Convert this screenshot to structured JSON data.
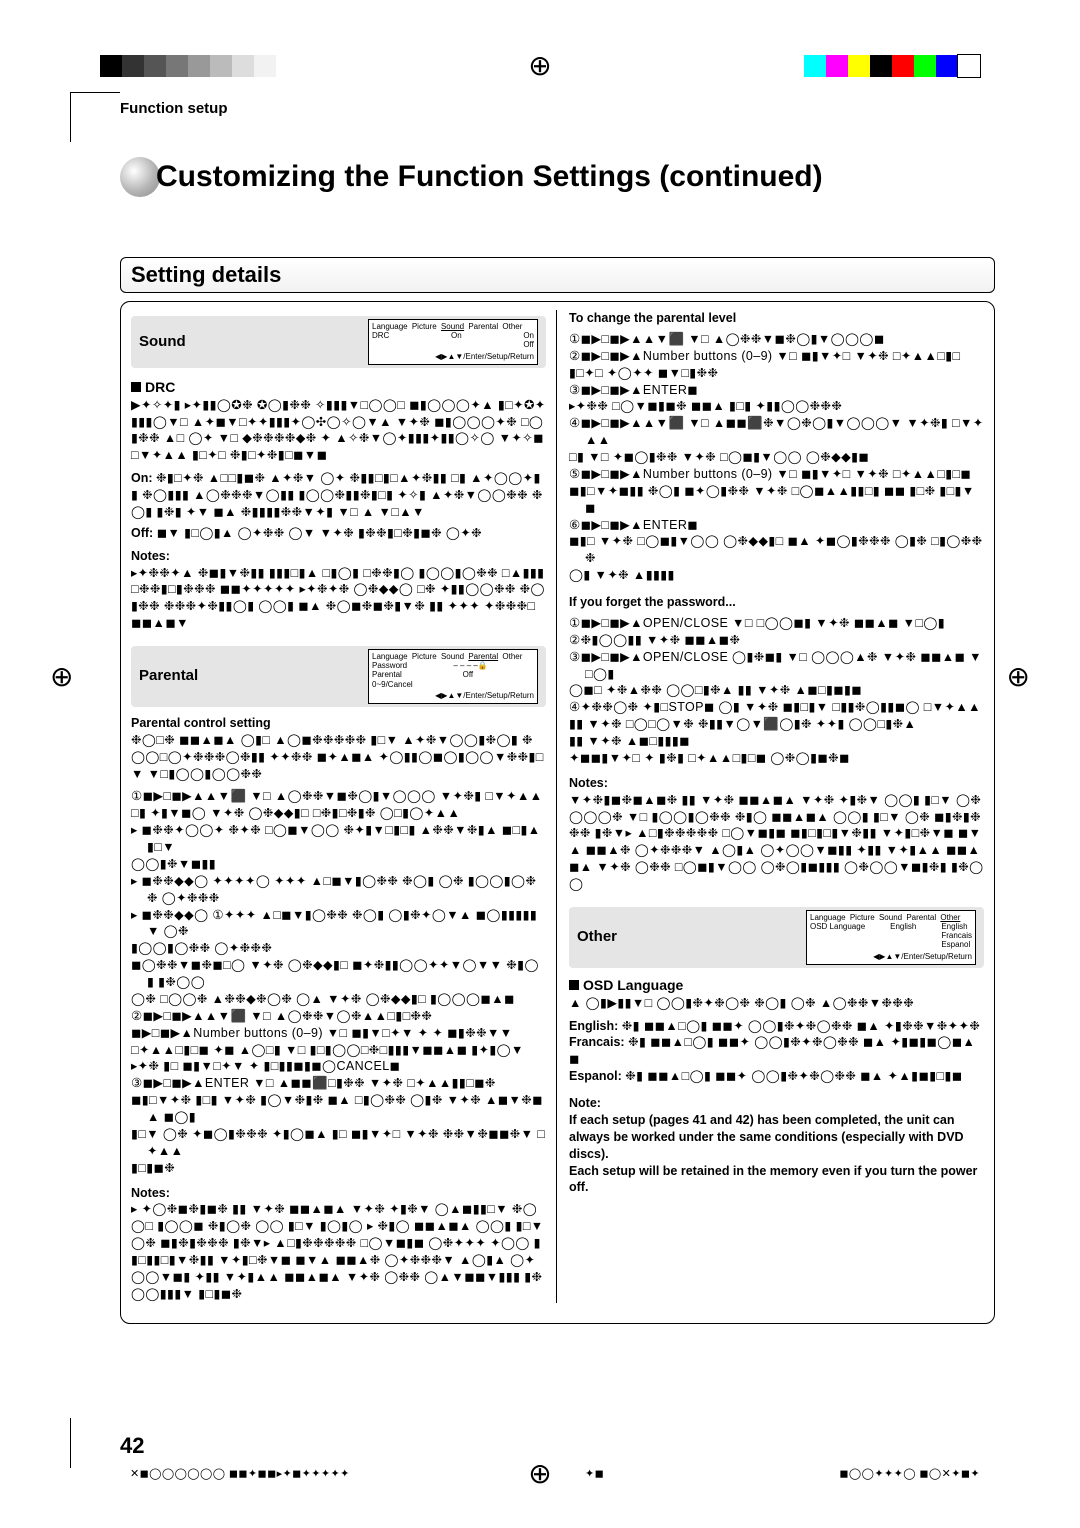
{
  "running_head": "Function setup",
  "title": "Customizing the Function Settings (continued)",
  "section_head": "Setting details",
  "page_number": "42",
  "registration": {
    "left_colors": [
      "#000",
      "#333",
      "#555",
      "#777",
      "#999",
      "#bbb",
      "#ddd",
      "#f2f2f2"
    ],
    "right_colors": [
      "#0ff",
      "#f0f",
      "#ff0",
      "#000",
      "#f00",
      "#0f0",
      "#00f",
      "#fff"
    ]
  },
  "left_col": {
    "sound_head": "Sound",
    "sound_menu": {
      "tabs": [
        "Language",
        "Picture",
        "Sound",
        "Parental",
        "Other"
      ],
      "selected_tab": "Sound",
      "rows": [
        {
          "label": "DRC",
          "sel": "On",
          "values": [
            "On",
            "Off"
          ]
        }
      ],
      "foot": "◀▶▲▼/Enter/Setup/Return"
    },
    "drc_label": "DRC",
    "drc_body": "▶✦✧✦▮ ▸✦▮▮◯✪❉ ✪◯▮❉❉ ✧▮▮▮▼□◯◯□ ◼▮◯◯◯✦▲ ▮□✦✪✦▮▮▮◯▼□ ▲✦◼▼□✦✦▮▮▮✦◯✣◯✧◯▼▲ ▼✦❉ ◼▮◯◯◯✦❉ □◯▮❉❉ ▲□ ◯✦ ▼□ ◆❉❉❉❉◆❉ ✦ ▲✧❉▼◯✦▮▮▮✦▮▮◯✧◯ ▼✦✧◼ □▼✦▲▲ ▮□✦□ ❉▮□✦❉▮□◼▼◼",
    "on_label": "On:",
    "on_body": "❉▮□✦❉ ▲□□▮◼❉ ▲✦❉▼ ◯✦ ❉▮▮□▮□▲✦❉▮▮ □▮ ▲✦◯◯✦▮▮ ❉◯▮▮▮ ▲◯❉❉❉▼◯▮▮ ▮◯◯❉▮▮❉▮□▮  ✦✧▮ ▲✦❉▼◯◯❉❉ ❉◯▮ ▮❉▮ ✦▼ ◼▲ ❉▮▮▮▮❉❉▼✦▮ ▼□ ▲ ▼□▲▼",
    "off_label": "Off:",
    "off_body": "◼▼ ▮□◯▮▲ ◯✦❉❉ ◯▼ ▼✦❉ ▮❉❉▮□❉▮◼❉ ◯✦❉",
    "notes_label": "Notes:",
    "notes_body": "▸✦❉❉✦▲ ❉◼▮▼❉▮▮ ▮▮▮□▮▲ □▮◯▮ □❉❉▮◯ ▮◯◯▮◯❉❉  □▲▮▮▮ □❉❉▮□▮❉❉❉ ◼◼✦✦✦✦✦ ▸✦❉✦❉ ◯❉◆◆◯ □❉ ✦▮▮◯◯❉❉ ❉◯▮❉❉ ❉❉❉✦❉▮▮◯▮ ◯◯▮ ◼▲ ❉◯◼❉◼❉▮▼❉ ▮▮ ✦✦✦ ✦❉❉❉□ ◼◼▲◼▼",
    "parental_head": "Parental",
    "parental_menu": {
      "tabs": [
        "Language",
        "Picture",
        "Sound",
        "Parental",
        "Other"
      ],
      "selected_tab": "Parental",
      "rows": [
        {
          "label": "Password",
          "sel": "– – – –🔒",
          "values": []
        },
        {
          "label": "Parental",
          "sel": "Off",
          "values": []
        }
      ],
      "extra": "0~9/Cancel",
      "foot": "◀▶▲▼/Enter/Setup/Return"
    },
    "pcs_label": "Parental control setting",
    "pcs_body": "❉◯□❉ ◼◼▲◼▲ ◯▮□ ▲◯◼❉❉❉❉❉ ▮□▼ ▲✦❉▼◯◯▮❉◯▮ ❉◯◯□◯✦❉❉❉◯❉▮▮ ✦✦❉❉ ◼✦▲◼▲ ✦◯▮▮◯◼◯▮◯◯▼❉❉▮□▼ ▼□▮◯◯▮◯◯❉❉",
    "steps": [
      "①◼▶□◼▶▲▲▼⬛ ▼□ ▲◯❉❉▼◼❉◯▮▼◯◯◯  ▼✦❉▮ □▼✦▲▲",
      "    □▮ ✦▮▼◼◯ ▼✦❉ ◯❉◆◆▮□ □❉▮□❉▮❉ ◯□▮◯✦▲▲",
      "▸ ◼❉❉✦◯◯✦ ❉✦❉ □◯◼▼◯◯ ❉✦▮▼□▮□▮ ▲❉❉▼❉▮▲ ◼□▮▲ ▮□▼",
      "    ◯◯▮❉▼◼▮▮",
      "▸ ◼❉❉◆◆◯ ✦✦✦✦◯ ✦✦✦ ▲□◼▼▮◯❉❉ ❉◯▮ ◯❉ ▮◯◯▮◯❉❉ ◯✦❉❉❉",
      "▸ ◼❉❉◆◆◯ ①✦✦✦ ▲□◼▼▮◯❉❉ ❉◯▮ ◯▮❉✦◯▼▲ ◼◯▮▮▮▮▮▼ ◯❉",
      "    ▮◯◯▮◯❉❉ ◯✦❉❉❉",
      "◼◯❉❉▼◼❉◼□◯ ▼✦❉ ◯❉◆◆▮□ ◼✦❉▮▮◯◯✦✦▼◯▼▼ ❉▮◯▮ ▮❉◯◯",
      "    ◯❉ □◯◯❉ ▲❉❉◆❉◯❉ ◯▲ ▼✦❉ ◯❉◆◆▮□ ▮◯◯◯◼▲◼",
      "②◼▶□◼▶▲▲▼⬛ ▼□ ▲◯❉❉▼◯❉▲▲□▮□❉❉",
      "   ◼▶□◼▶▲Number buttons (0–9) ▼□ ◼▮▼□✦▼ ✦ ✦   ◼▮❉❉▼▼",
      "   □✦▲▲□▮□◼  ✦◼ ▲◯□▮ ▼□ ▮□▮◯◯□❉□▮▮▮▼◼◼▲◼ ▮✦▮◯▼",
      "▸✦❉ ▮□ ◼▮▼□✦▼ ✦ ▮□▮▮◼▮◼◯CANCEL◼",
      "③◼▶□◼▶▲ENTER ▼□ ▲◼◼⬛□▮❉❉ ▼✦❉ □✦▲▲▮▮□◼❉",
      "   ◼▮□▼✦❉ ▮□▮ ▼✦❉ ▮◯▼❉▮❉ ◼▲ □▮◯❉❉ ◯▮❉ ▼✦❉ ▲◼▼❉◼▲ ◼◯▮",
      "   ▮□▼ ◯❉ ✦◼◯▮❉❉❉ ✦▮◯◼▲ ▮□ ◼▮▼✦□ ▼✦❉  ❉❉▼❉◼◼❉▼ □✦▲▲",
      "   ▮□▮◼❉"
    ],
    "notes2_label": "Notes:",
    "notes2_body": "▸ ✦◯❉◼❉▮◼❉ ▮▮ ▼✦❉ ◼◼▲◼▲ ▼✦❉ ✦▮❉▼ ◯▲◼▮▮□▼   ❉◯◯□ ▮◯◯◼ ❉▮◯❉ ◯◯ ▮□▼ ▮◯▮◯ ▸ ❉▮◯ ◼◼▲◼▲ ◯◯▮ ▮□▼ ◯❉ ◼▮❉▮❉❉❉ ▮❉▼▸ ▲□▮❉❉❉❉❉ □◯▼◼▮◼  ◯❉✦✦✦ ✦◯◯ ▮▮□▮▮□▮▼❉▮▮ ▼✦▮□❉▼◼ ◼▼▲ ◼◼▲❉ ◯✦❉❉❉▼ ▲◯▮▲ ◯✦◯◯▼◼▮ ✦▮▮ ▼✦▮▲▲ ◼◼▲◼▲ ▼✦❉ ◯❉❉ ◯▲▼◼◼▼▮▮▮ ▮❉◯◯▮▮▮▼ ▮□▮◼❉"
  },
  "right_col": {
    "change_head": "To change the parental level",
    "change_body": [
      "①◼▶□◼▶▲▲▼⬛ ▼□ ▲◯❉❉▼◼❉◯▮▼◯◯◯◼",
      "②◼▶□◼▶▲Number buttons (0–9) ▼□ ◼▮▼✦□ ▼✦❉ □✦▲▲□▮□",
      "   ▮□✦□ ✦◯✦✦ ◼▼□▮❉❉",
      "③◼▶□◼▶▲ENTER◼",
      "   ▸✦❉❉ □◯▼◼▮◼❉ ◼◼▲ ▮□▮ ✦▮▮◯◯❉❉❉",
      "④◼▶□◼▶▲▲▼⬛ ▼□ ▲◼◼⬛❉▼◯❉◯▮▼◯◯◯▼ ▼✦❉▮ □▼✦▲▲",
      "   □▮ ▼□ ✦◼◯▮❉❉ ▼✦❉ □◯◼▮▼◯◯ ◯❉◆◆▮◼",
      "⑤◼▶□◼▶▲Number buttons (0–9) ▼□ ◼▮▼✦□ ▼✦❉ □✦▲▲□▮□◼",
      "   ◼▮□▼✦◼▮▮ ❉◯▮ ◼✦◯▮❉❉ ▼✦❉ □◯◼▲▲▮▮□▮ ◼◼ ▮□❉ ▮□▮▼◼",
      "⑥◼▶□◼▶▲ENTER◼",
      "   ◼▮□ ▼✦❉ □◯◼▮▼◯◯ ◯❉◆◆▮□ ◼▲ ✦◼◯▮❉❉❉ ◯▮❉ □▮◯❉❉❉",
      "   ◯▮ ▼✦❉ ▲▮▮▮▮"
    ],
    "forget_head": "If you forget the password...",
    "forget_body": [
      "①◼▶□◼▶▲OPEN/CLOSE ▼□ □◯◯◼▮ ▼✦❉ ◼◼▲◼ ▼□◯▮",
      "②❉▮◯◯▮▮ ▼✦❉ ◼◼▲◼❉",
      "③◼▶□◼▶▲OPEN/CLOSE ◯▮❉◼▮ ▼□ ◯◯◯▲❉ ▼✦❉ ◼◼▲◼ ▼□◯▮",
      "   ◯◼□ ✦❉▲❉❉ ◯◯□▮❉▲ ▮▮ ▼✦❉ ▲◼□▮◼▮◼",
      "④✦❉❉◯❉ ✦▮□STOP◼   ◯▮ ▼✦❉ ◼▮□▮▼ □▮▮❉◯▮▮◼◯ □▼✦▲▲",
      "   ▮▮ ▼✦❉ □◯□◯▼❉ ❉▮▮▼◯▼⬛◯▮❉   ✦✦▮ ◯◯□▮❉▲",
      "   ▮▮ ▼✦❉ ▲◼□▮▮▮◼",
      "✦◼◼▮▼✦□ ✦ ▮❉▮ □✦▲▲□▮□◼ ◯❉◯▮◼❉◼"
    ],
    "notes_label": "Notes:",
    "notes_body": "▼✦❉▮◼❉◼▲◼❉ ▮▮ ▼✦❉ ◼◼▲◼▲ ▼✦❉ ✦▮❉▼ ◯◯▮ ▮□▼ ◯❉ ◯◯◯❉ ▼□  ▮◯◯▮◯❉❉  ❉▮◯ ◼◼▲◼▲ ◯◯▮ ▮□▼ ◯❉ ◼▮❉▮❉❉❉ ▮❉▼▸ ▲□▮❉❉❉❉❉ □◯▼◼▮◼  ◼▮□▮□▮▼❉▮▮ ▼✦▮□❉▼◼ ◼▼▲ ◼◼▲❉ ◯✦❉❉❉▼ ▲◯▮▲ ◯✦◯◯▼◼▮▮ ✦▮▮ ▼✦▮▲▲ ◼◼▲◼▲ ▼✦❉ ◯❉❉ □◯◼▮▼◯◯ ◯❉◯▮◼▮▮▮ ◯❉◯◯▼◼▮❉▮ ▮❉◯◯",
    "other_head": "Other",
    "other_menu": {
      "tabs": [
        "Language",
        "Picture",
        "Sound",
        "Parental",
        "Other"
      ],
      "selected_tab": "Other",
      "rows": [
        {
          "label": "OSD Language",
          "sel": "English",
          "values": [
            "English",
            "Francais",
            "Espanol"
          ]
        }
      ],
      "foot": "◀▶▲▼/Enter/Setup/Return"
    },
    "osd_label": "OSD Language",
    "osd_body": "▲ ◯▮▶▮▮▼□ ◯◯▮❉✦❉◯❉ ❉◯▮ ◯❉ ▲◯❉❉▼❉❉❉",
    "lang_labels": {
      "english": "English:",
      "english_body": "❉▮ ◼◼▲□◯▮ ◼◼✦ ◯◯▮❉✦❉◯❉❉ ◼▲ ✦▮❉❉▼❉✦✦❉",
      "francais": "Francais:",
      "francais_body": "❉▮ ◼◼▲□◯▮ ◼◼✦ ◯◯▮❉✦❉◯❉❉ ◼▲ ✦▮◼▮◼◯◼▲◼",
      "espanol": "Espanol:",
      "espanol_body": "❉▮ ◼◼▲□◯▮ ◼◼✦ ◯◯▮❉✦❉◯❉❉ ◼▲ ✦▲▮◼▮□▮◼"
    },
    "note_label": "Note:",
    "note_body1": "If each setup (pages 41 and 42) has been completed, the unit can always be worked under the same conditions (especially with DVD discs).",
    "note_body2": "Each setup will be retained in the memory even if you turn the power off."
  },
  "foot_meta": {
    "left": "✕◼◯◯◯◯◯◯ ◼◼✦◼◼▸✦◼✦✦✦✦✦",
    "mid": "✦◼",
    "right": "◼◯◯✦✦✦◯ ◼◯✕✦◼✦"
  }
}
